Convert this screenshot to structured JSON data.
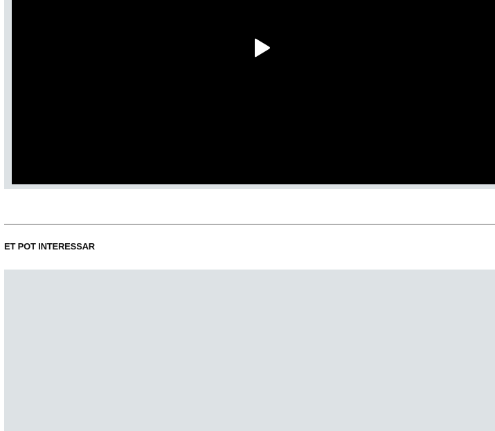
{
  "video": {
    "play_icon": "play-icon",
    "frame_color": "#dde2e5",
    "player_color": "#000000"
  },
  "related": {
    "heading": "ET POT INTERESSAR",
    "placeholder_color": "#dde2e5"
  }
}
